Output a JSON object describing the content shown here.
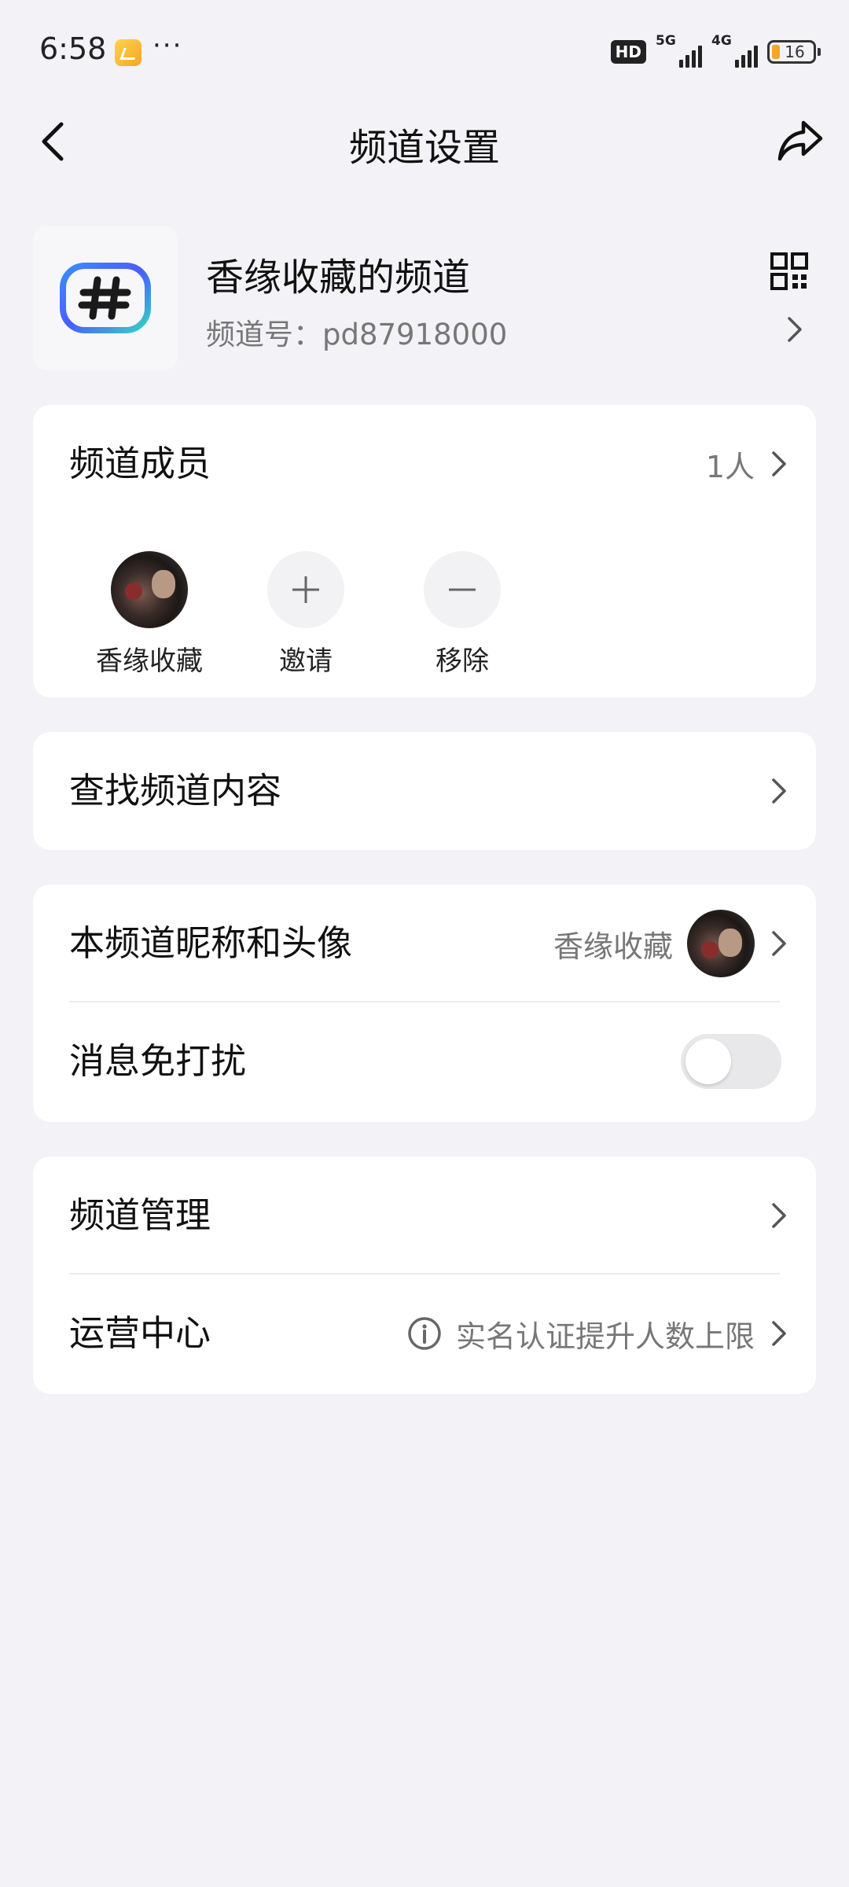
{
  "status_bar": {
    "time": "6:58",
    "more": "···",
    "hd_label": "HD",
    "network_1": "5G",
    "network_2": "4G",
    "battery": "16"
  },
  "nav": {
    "title": "频道设置"
  },
  "channel": {
    "name": "香缘收藏的频道",
    "id_text": "频道号：pd87918000"
  },
  "members_card": {
    "title": "频道成员",
    "count": "1人",
    "members": [
      {
        "label": "香缘收藏"
      },
      {
        "label": "邀请"
      },
      {
        "label": "移除"
      }
    ]
  },
  "search_card": {
    "label": "查找频道内容"
  },
  "profile_card": {
    "nickname_label": "本频道昵称和头像",
    "nickname_value": "香缘收藏",
    "dnd_label": "消息免打扰",
    "dnd_on": false
  },
  "manage_card": {
    "manage_label": "频道管理",
    "ops_label": "运营中心",
    "ops_hint": "实名认证提升人数上限"
  },
  "colors": {
    "background": "#f2f2f7",
    "card": "#ffffff",
    "secondary_text": "#777777"
  }
}
